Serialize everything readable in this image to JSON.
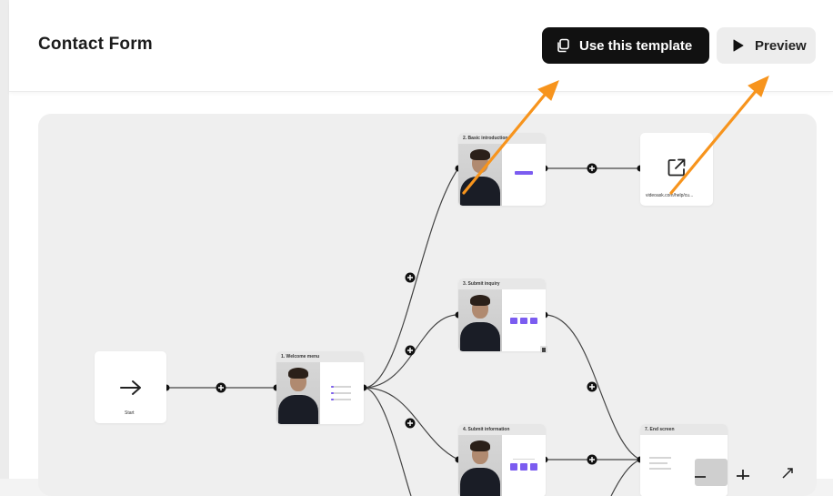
{
  "header": {
    "title": "Contact Form",
    "use_template_label": "Use this template",
    "preview_label": "Preview"
  },
  "flow": {
    "start_label": "Start",
    "nodes": [
      {
        "title": "1. Welcome menu"
      },
      {
        "title": "2. Basic introduction"
      },
      {
        "title": "3. Submit inquiry"
      },
      {
        "title": "4. Submit information"
      },
      {
        "title": "7. End screen"
      }
    ],
    "link_label": "videoask.com/help/cu..."
  },
  "icons": {
    "copy": "copy-icon",
    "play": "play-icon",
    "start": "arrow-right-icon",
    "external": "external-link-icon",
    "zoom_out": "minus-icon",
    "zoom_in": "plus-icon",
    "fullscreen": "expand-icon"
  },
  "colors": {
    "accent": "#7b5cf0",
    "annotation_arrow": "#f7941d",
    "primary_button": "#111111"
  }
}
